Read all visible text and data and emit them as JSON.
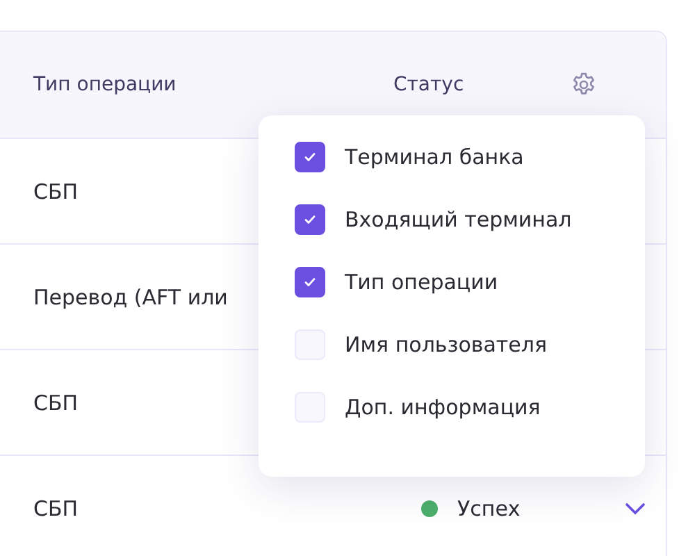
{
  "table": {
    "columns": [
      "Тип операции",
      "Статус"
    ],
    "rows": [
      {
        "operation_type": "СБП"
      },
      {
        "operation_type": "Перевод (AFT или"
      },
      {
        "operation_type": "СБП"
      },
      {
        "operation_type": "СБП",
        "status": {
          "text": "Успех",
          "color": "#4caf6a"
        }
      }
    ]
  },
  "column_menu": {
    "items": [
      {
        "label": "Терминал банка",
        "checked": true
      },
      {
        "label": "Входящий терминал",
        "checked": true
      },
      {
        "label": "Тип операции",
        "checked": true
      },
      {
        "label": "Имя пользователя",
        "checked": false
      },
      {
        "label": "Доп. информация",
        "checked": false
      }
    ]
  }
}
